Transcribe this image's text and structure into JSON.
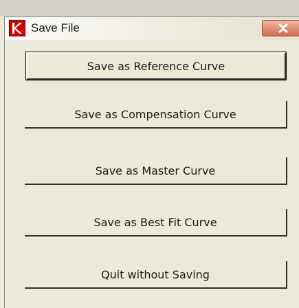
{
  "window": {
    "title": "Save File",
    "icon": "app-k-logo-icon",
    "close_icon": "close-x-icon"
  },
  "buttons": {
    "save_reference": "Save as Reference Curve",
    "save_compensation": "Save as Compensation Curve",
    "save_master": "Save as Master Curve",
    "save_best_fit": "Save as Best Fit Curve",
    "quit": "Quit without Saving"
  },
  "colors": {
    "dialog_bg": "#ece9d8",
    "close_button": "#cf6b4f",
    "app_icon": "#d40000"
  }
}
